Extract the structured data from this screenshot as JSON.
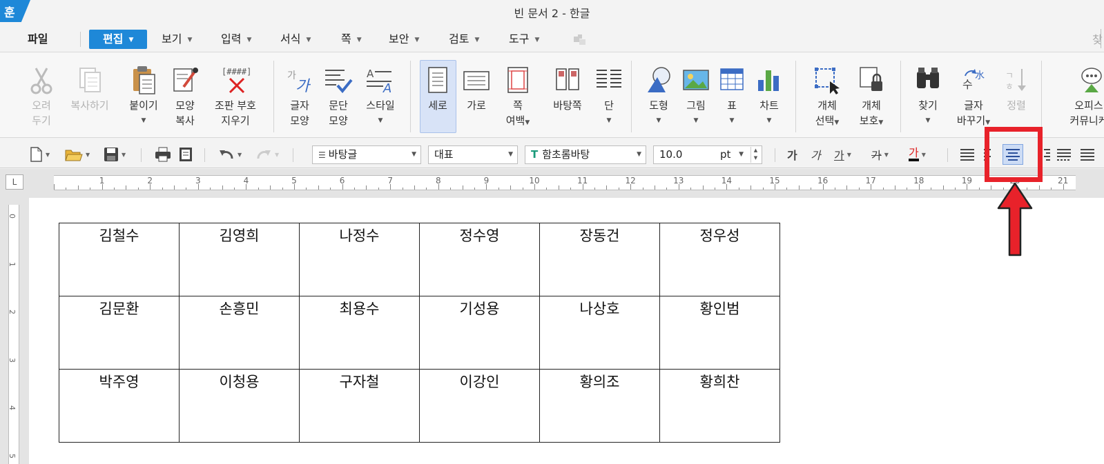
{
  "app": {
    "logo_text": "훈",
    "window_title": "빈 문서 2 - 한글"
  },
  "menu": {
    "file": "파일",
    "items": [
      "편집",
      "보기",
      "입력",
      "서식",
      "쪽",
      "보안",
      "검토",
      "도구"
    ],
    "search_label": "찾"
  },
  "ribbon": {
    "cut": [
      "오려",
      "두기"
    ],
    "copy": "복사하기",
    "paste": "붙이기",
    "format_copy": [
      "모양",
      "복사"
    ],
    "clear_marks": [
      "조판 부호",
      "지우기"
    ],
    "char_shape": [
      "글자",
      "모양"
    ],
    "para_shape": [
      "문단",
      "모양"
    ],
    "style": "스타일",
    "portrait": "세로",
    "landscape": "가로",
    "page_margin": [
      "쪽",
      "여백"
    ],
    "master_page": "바탕쪽",
    "columns": "단",
    "shape": "도형",
    "picture": "그림",
    "table": "표",
    "chart": "차트",
    "object_select": [
      "개체",
      "선택"
    ],
    "object_protect": [
      "개체",
      "보호"
    ],
    "find": "찾기",
    "replace": [
      "글자",
      "바꾸기"
    ],
    "sort": "정렬",
    "office": [
      "오피스",
      "커뮤니케"
    ]
  },
  "format_bar": {
    "style": "바탕글",
    "lang": "대표",
    "font": "함초롬바탕",
    "size": "10.0",
    "unit": "pt",
    "bold": "가",
    "italic": "가",
    "underline": "가",
    "strike": "가",
    "color": "가"
  },
  "ruler": {
    "corner": "L"
  },
  "table": {
    "rows": [
      [
        "김철수",
        "김영희",
        "나정수",
        "정수영",
        "장동건",
        "정우성"
      ],
      [
        "김문환",
        "손흥민",
        "최용수",
        "기성용",
        "나상호",
        "황인범"
      ],
      [
        "박주영",
        "이청용",
        "구자철",
        "이강인",
        "황의조",
        "황희찬"
      ]
    ]
  },
  "colors": {
    "accent": "#1e88d8",
    "highlight": "#e8222a",
    "selected_bg": "#d8e3f7"
  }
}
